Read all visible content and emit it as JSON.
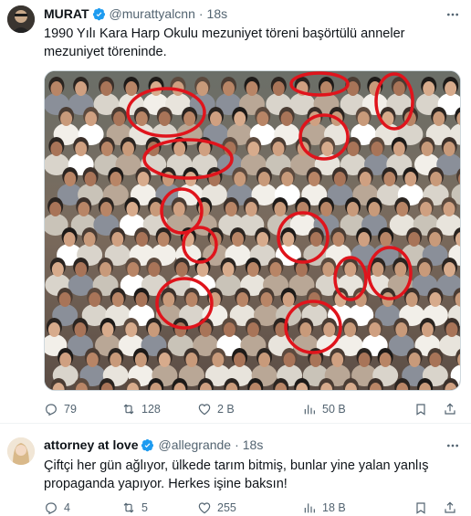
{
  "tweets": [
    {
      "display_name": "MURAT",
      "handle": "@murattyalcnn",
      "separator": "·",
      "time": "18s",
      "text": "1990 Yılı Kara Harp Okulu mezuniyet töreni başörtülü anneler mezuniyet töreninde.",
      "media": {
        "type": "photo",
        "highlight_color": "#e0141c"
      },
      "stats": {
        "replies": "79",
        "reposts": "128",
        "likes": "2 B",
        "views": "50 B"
      }
    },
    {
      "display_name": "attorney at love",
      "handle": "@allegrande",
      "separator": "·",
      "time": "18s",
      "text": "Çiftçi her gün ağlıyor, ülkede tarım bitmiş, bunlar yine yalan yanlış propaganda yapıyor. Herkes işine baksın!",
      "stats": {
        "replies": "4",
        "reposts": "5",
        "likes": "255",
        "views": "18 B"
      }
    }
  ],
  "icons": {
    "more": "more-horizontal-icon",
    "verified": "verified-badge-icon",
    "reply": "reply-icon",
    "repost": "repost-icon",
    "like": "heart-icon",
    "views": "views-chart-icon",
    "bookmark": "bookmark-icon",
    "share": "share-icon"
  },
  "colors": {
    "verified": "#1d9bf0",
    "muted_text": "#536471",
    "highlight": "#e0141c"
  }
}
